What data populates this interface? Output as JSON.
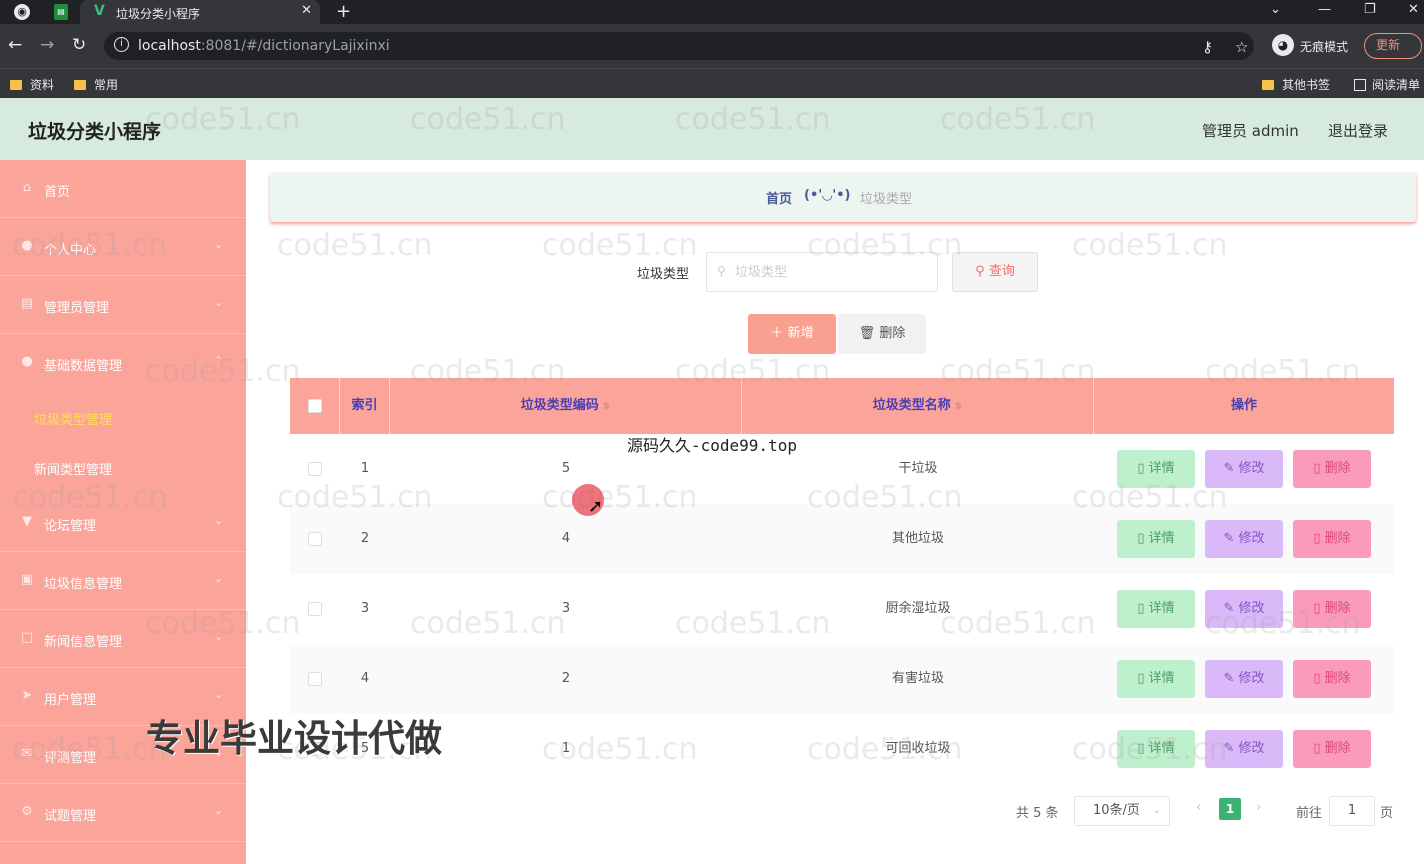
{
  "browser": {
    "tab_title": "垃圾分类小程序",
    "tab_close": "✕",
    "new_tab": "+",
    "url_host": "localhost",
    "url_rest": ":8081/#/dictionaryLajixinxi",
    "incognito_label": "无痕模式",
    "update_label": "更新",
    "bookmarks": [
      "资料",
      "常用",
      "其他书签",
      "阅读清单"
    ]
  },
  "header": {
    "title": "垃圾分类小程序",
    "admin_label": "管理员 admin",
    "logout_label": "退出登录"
  },
  "sidebar": {
    "items": [
      {
        "label": "首页",
        "icon": "home-icon"
      },
      {
        "label": "个人中心",
        "icon": "user-icon"
      },
      {
        "label": "管理员管理",
        "icon": "list-icon"
      },
      {
        "label": "基础数据管理",
        "icon": "user-icon"
      },
      {
        "label": "论坛管理",
        "icon": "forum-icon"
      },
      {
        "label": "垃圾信息管理",
        "icon": "trash-icon"
      },
      {
        "label": "新闻信息管理",
        "icon": "news-icon"
      },
      {
        "label": "用户管理",
        "icon": "send-icon"
      },
      {
        "label": "评测管理",
        "icon": "mail-icon"
      },
      {
        "label": "试题管理",
        "icon": "gear-icon"
      }
    ],
    "subitems": [
      {
        "label": "垃圾类型管理",
        "active": true
      },
      {
        "label": "新闻类型管理",
        "active": false
      }
    ]
  },
  "breadcrumb": {
    "home": "首页",
    "separator": "(•'◡'•)",
    "current": "垃圾类型"
  },
  "search": {
    "label": "垃圾类型",
    "placeholder": "垃圾类型",
    "query_label": "查询"
  },
  "actions": {
    "add_label": "新增",
    "delete_label": "删除"
  },
  "table": {
    "columns": [
      "索引",
      "垃圾类型编码",
      "垃圾类型名称",
      "操作"
    ],
    "rows": [
      {
        "index": "1",
        "code": "5",
        "name": "干垃圾"
      },
      {
        "index": "2",
        "code": "4",
        "name": "其他垃圾"
      },
      {
        "index": "3",
        "code": "3",
        "name": "厨余湿垃圾"
      },
      {
        "index": "4",
        "code": "2",
        "name": "有害垃圾"
      },
      {
        "index": "5",
        "code": "1",
        "name": "可回收垃圾"
      }
    ],
    "row_actions": {
      "detail": "详情",
      "edit": "修改",
      "delete": "删除"
    }
  },
  "pagination": {
    "total": "共 5 条",
    "page_size": "10条/页",
    "current_page": "1",
    "goto_label": "前往",
    "goto_value": "1",
    "page_suffix": "页"
  },
  "overlays": {
    "watermark": "code51.cn",
    "site_text": "源码久久-code99.top",
    "ad_text": "专业毕业设计代做"
  },
  "colors": {
    "header_bg": "#d7eade",
    "sidebar_bg": "#fba49a",
    "table_header_bg": "#fba49a",
    "pagination_active": "#3bb372"
  }
}
